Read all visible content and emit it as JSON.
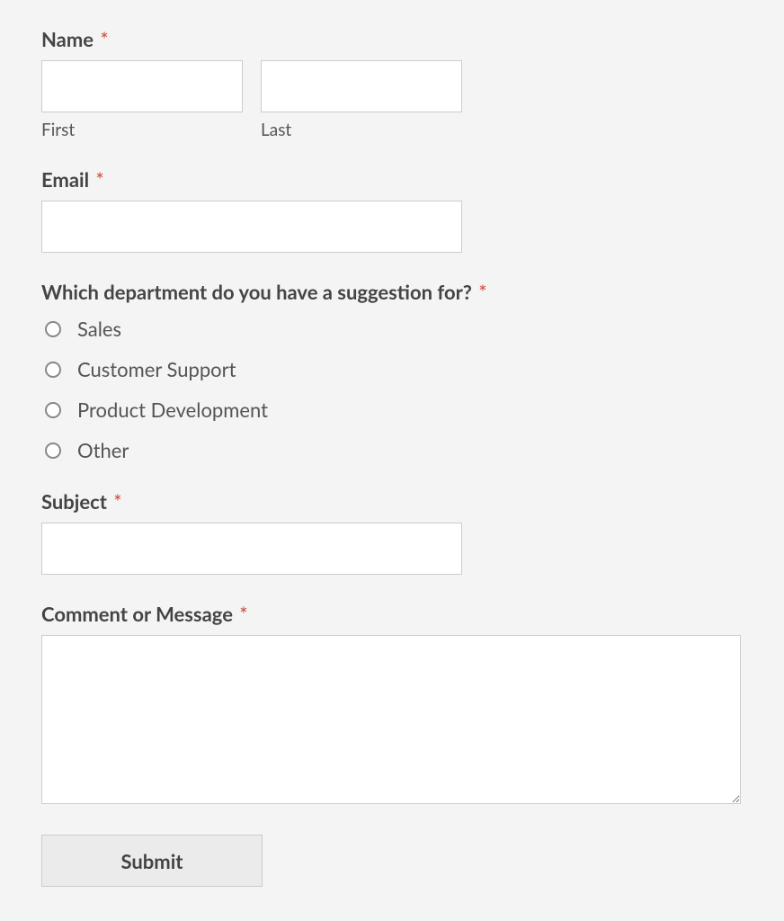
{
  "form": {
    "name": {
      "label": "Name",
      "required": "*",
      "first_sublabel": "First",
      "last_sublabel": "Last",
      "first_value": "",
      "last_value": ""
    },
    "email": {
      "label": "Email",
      "required": "*",
      "value": ""
    },
    "department": {
      "label": "Which department do you have a suggestion for?",
      "required": "*",
      "options": [
        "Sales",
        "Customer Support",
        "Product Development",
        "Other"
      ]
    },
    "subject": {
      "label": "Subject",
      "required": "*",
      "value": ""
    },
    "message": {
      "label": "Comment or Message",
      "required": "*",
      "value": ""
    },
    "submit_label": "Submit"
  }
}
